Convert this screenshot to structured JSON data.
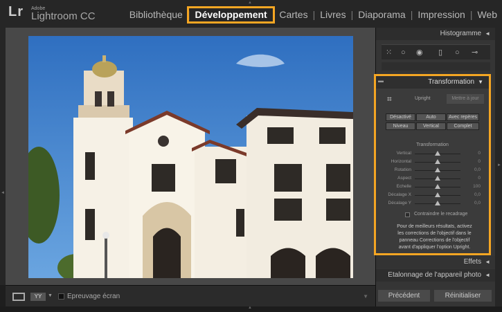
{
  "app": {
    "logo_mark": "Lr",
    "brand": "Adobe",
    "product": "Lightroom CC"
  },
  "modules": [
    {
      "label": "Bibliothèque",
      "active": false
    },
    {
      "label": "Développement",
      "active": true
    },
    {
      "label": "Cartes",
      "active": false
    },
    {
      "label": "Livres",
      "active": false
    },
    {
      "label": "Diaporama",
      "active": false
    },
    {
      "label": "Impression",
      "active": false
    },
    {
      "label": "Web",
      "active": false
    }
  ],
  "colors": {
    "highlight": "#f5a623",
    "sky": "#3a7fce",
    "facade": "#f4eee2"
  },
  "right_panel": {
    "histogram_label": "Histogramme",
    "collapse_glyph": "◄",
    "expand_glyph": "▼",
    "tools": [
      "grid-overlay-icon",
      "crop-tool-icon",
      "spot-removal-icon",
      "graduated-filter-icon",
      "radial-filter-icon",
      "adjustment-brush-icon"
    ],
    "effets_label": "Effets",
    "calibration_label": "Etalonnage de l'appareil photo"
  },
  "transformation": {
    "title": "Transformation",
    "upright_label": "Upright",
    "update_label": "Mettre à jour",
    "modes_row1": [
      "Désactivé",
      "Auto",
      "Avec repères"
    ],
    "modes_row2": [
      "Niveau",
      "Vertical",
      "Complet"
    ],
    "section_title": "Transformation",
    "sliders": [
      {
        "label": "Vertical",
        "value": "0",
        "pos": 0.5
      },
      {
        "label": "Horizontal",
        "value": "0",
        "pos": 0.5
      },
      {
        "label": "Rotation",
        "value": "0,0",
        "pos": 0.5
      },
      {
        "label": "Aspect",
        "value": "0",
        "pos": 0.5
      },
      {
        "label": "Echelle",
        "value": "100",
        "pos": 0.5
      },
      {
        "label": "Décalage X",
        "value": "0,0",
        "pos": 0.5
      },
      {
        "label": "Décalage Y",
        "value": "0,0",
        "pos": 0.5
      }
    ],
    "constrain_label": "Contraindre le recadrage",
    "hint": "Pour de meilleurs résultats, activez\nles corrections de l'objectif dans le\npanneau Corrections de l'objectif\navant d'appliquer l'option Upright."
  },
  "toolbar": {
    "view_yy": "YY",
    "softproof_label": "Epreuvage écran"
  },
  "buttons": {
    "previous": "Précédent",
    "reset": "Réinitialiser"
  }
}
